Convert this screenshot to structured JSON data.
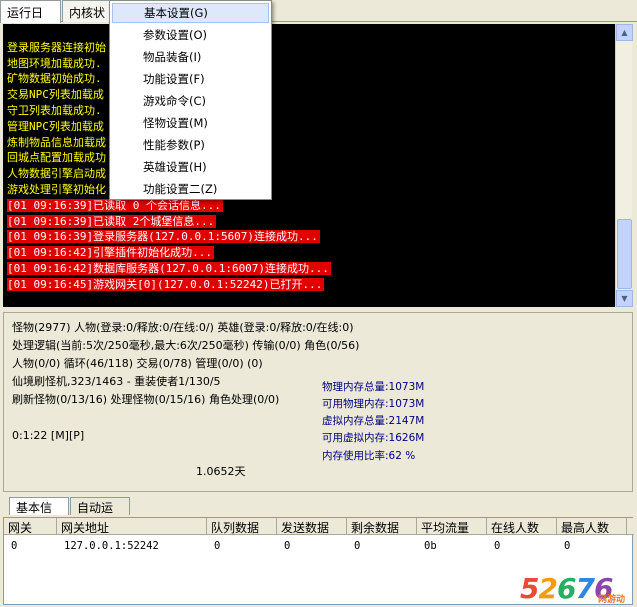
{
  "tabs": [
    {
      "label": "运行日志"
    },
    {
      "label": "内核状"
    }
  ],
  "menu": {
    "items": [
      {
        "label": "基本设置(G)"
      },
      {
        "label": "参数设置(O)"
      },
      {
        "label": "物品装备(I)"
      },
      {
        "label": "功能设置(F)"
      },
      {
        "label": "游戏命令(C)"
      },
      {
        "label": "怪物设置(M)"
      },
      {
        "label": "性能参数(P)"
      },
      {
        "label": "英雄设置(H)"
      },
      {
        "label": "功能设置二(Z)"
      }
    ]
  },
  "log": {
    "lines": [
      {
        "text": "",
        "color": "yellow"
      },
      {
        "text": "登录服务器连接初始",
        "color": "yellow"
      },
      {
        "text": "地图环境加载成功.",
        "color": "yellow"
      },
      {
        "text": "矿物数据初始成功.",
        "color": "yellow"
      },
      {
        "text": "交易NPC列表加载成",
        "color": "yellow"
      },
      {
        "text": "守卫列表加载成功.",
        "color": "yellow"
      },
      {
        "text": "管理NPC列表加载成",
        "color": "yellow"
      },
      {
        "text": "炼制物品信息加载成",
        "color": "yellow"
      },
      {
        "text": "回城点配置加载成功",
        "color": "yellow"
      },
      {
        "text": "人物数据引擎启动成",
        "color": "yellow"
      },
      {
        "text": "游戏处理引擎初始化",
        "color": "yellow"
      },
      {
        "text": "[01 09:16:39]已读取 0 个会话信息...",
        "color": "red"
      },
      {
        "text": "[01 09:16:39]已读取 2个城堡信息...",
        "color": "red"
      },
      {
        "text": "[01 09:16:39]登录服务器(127.0.0.1:5607)连接成功...",
        "color": "red"
      },
      {
        "text": "[01 09:16:42]引擎插件初始化成功...",
        "color": "red"
      },
      {
        "text": "[01 09:16:42]数据库服务器(127.0.0.1:6007)连接成功...",
        "color": "red"
      },
      {
        "text": "[01 09:16:45]游戏网关[0](127.0.0.1:52242)已打开...",
        "color": "red"
      }
    ]
  },
  "stats": {
    "line1": "怪物(2977) 人物(登录:0/释放:0/在线:0/) 英雄(登录:0/释放:0/在线:0)",
    "line2": "处理逻辑(当前:5次/250毫秒,最大:6次/250毫秒) 传输(0/0) 角色(0/56)",
    "line3": "人物(0/0) 循环(46/118) 交易(0/78) 管理(0/0)  (0)",
    "line4": "仙境刷怪机,323/1463 - 重装使者1/130/5",
    "line5": "刷新怪物(0/13/16) 处理怪物(0/15/16) 角色处理(0/0)",
    "runtime": "0:1:22 [M][P]",
    "days": "1.0652天",
    "memory": [
      "物理内存总量:1073M",
      "可用物理内存:1073M",
      "虚拟内存总量:2147M",
      "可用虚拟内存:1626M",
      "内存使用比率:62 %"
    ]
  },
  "bottom_tabs": [
    {
      "label": "基本信息"
    },
    {
      "label": "自动运行"
    }
  ],
  "table": {
    "headers": [
      "网关",
      "网关地址",
      "队列数据",
      "发送数据",
      "剩余数据",
      "平均流量",
      "在线人数",
      "最高人数"
    ],
    "rows": [
      [
        "0",
        "127.0.0.1:52242",
        "0",
        "0",
        "0",
        "0b",
        "0",
        "0"
      ]
    ]
  },
  "watermark": {
    "text": "52676",
    "sub": "网游动力"
  },
  "colors": {
    "log_bg": "#000000",
    "log_yellow": "#ffff00",
    "log_red_highlight": "#e00000",
    "menu_hover": "#dde8fa",
    "memory_text": "#00007f"
  }
}
